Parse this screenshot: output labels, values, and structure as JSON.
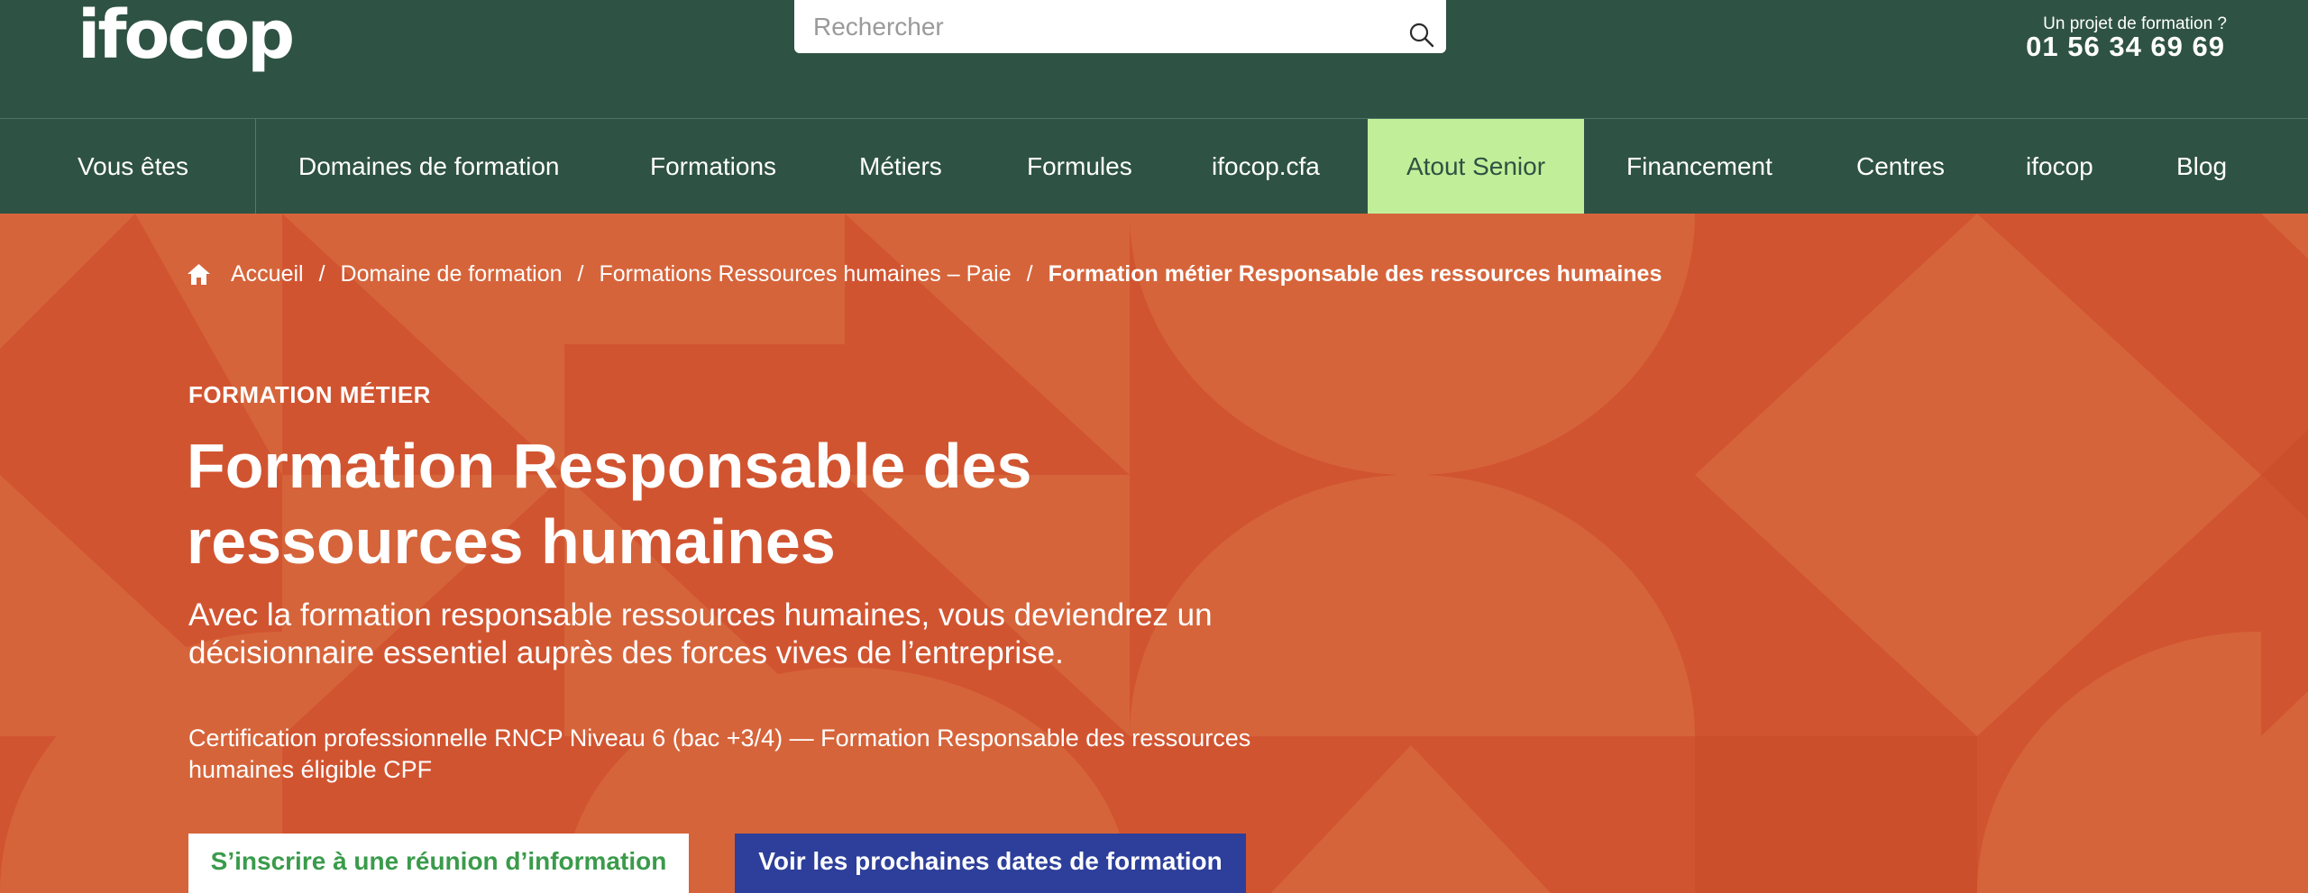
{
  "header": {
    "logo_text": "ifocop",
    "search_placeholder": "Rechercher",
    "contact_label": "Un projet de formation ?",
    "contact_phone": "01 56 34 69 69"
  },
  "nav": {
    "items": [
      {
        "label": "Vous êtes"
      },
      {
        "label": "Domaines de formation"
      },
      {
        "label": "Formations"
      },
      {
        "label": "Métiers"
      },
      {
        "label": "Formules"
      },
      {
        "label": "ifocop.cfa"
      },
      {
        "label": "Atout Senior",
        "active": true
      },
      {
        "label": "Financement"
      },
      {
        "label": "Centres"
      },
      {
        "label": "ifocop"
      },
      {
        "label": "Blog"
      }
    ]
  },
  "breadcrumb": {
    "items": [
      {
        "label": "Accueil"
      },
      {
        "label": "Domaine de formation"
      },
      {
        "label": "Formations Ressources humaines – Paie"
      },
      {
        "label": "Formation métier Responsable des ressources humaines"
      }
    ],
    "separator": "/"
  },
  "hero": {
    "kicker": "FORMATION MÉTIER",
    "title": "Formation Responsable des ressources humaines",
    "subtitle": "Avec la formation responsable ressources humaines, vous deviendrez un décisionnaire essentiel auprès des forces vives de l’entreprise.",
    "certification": "Certification professionnelle RNCP Niveau 6 (bac +3/4) — Formation Responsable des ressources humaines éligible CPF",
    "cta_info": "S’inscrire à une réunion d’information",
    "cta_dates": "Voir les prochaines dates de formation"
  },
  "colors": {
    "header_bg": "#2e5243",
    "nav_active_bg": "#c1ef99",
    "hero_bg": "#d15430",
    "hero_pattern_light": "#d6643a",
    "cta_info_text": "#3a9b4b",
    "cta_dates_bg": "#2d3f9a"
  }
}
